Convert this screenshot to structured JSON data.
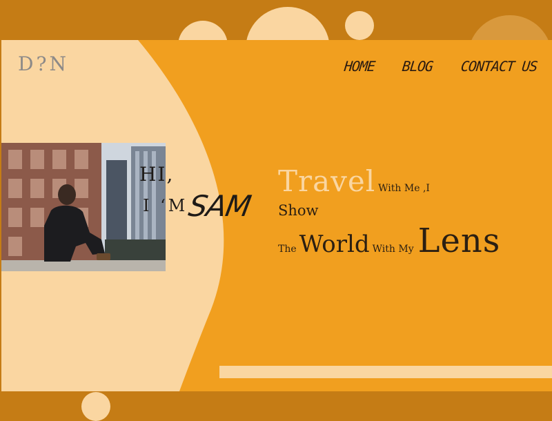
{
  "colors": {
    "background": "#c57c15",
    "card": "#f19f1f",
    "cream": "#fad6a1",
    "text_dark": "#2b1f12",
    "logo_gray": "#8d8a88"
  },
  "logo": {
    "text": "D?N"
  },
  "nav": {
    "items": [
      {
        "label": "HOME"
      },
      {
        "label": "BLOG"
      },
      {
        "label": "CONTACT US"
      }
    ]
  },
  "hero": {
    "photo_icon": "person-sitting-rooftop-photo",
    "greeting_line1": "HI,",
    "greeting_line2": "I ‘M",
    "name": "SAM"
  },
  "tagline": {
    "travel": "Travel",
    "with_me": "With Me ,I",
    "show": "Show",
    "the": "The",
    "world": "World",
    "with_my": "With My",
    "lens": "Lens"
  }
}
